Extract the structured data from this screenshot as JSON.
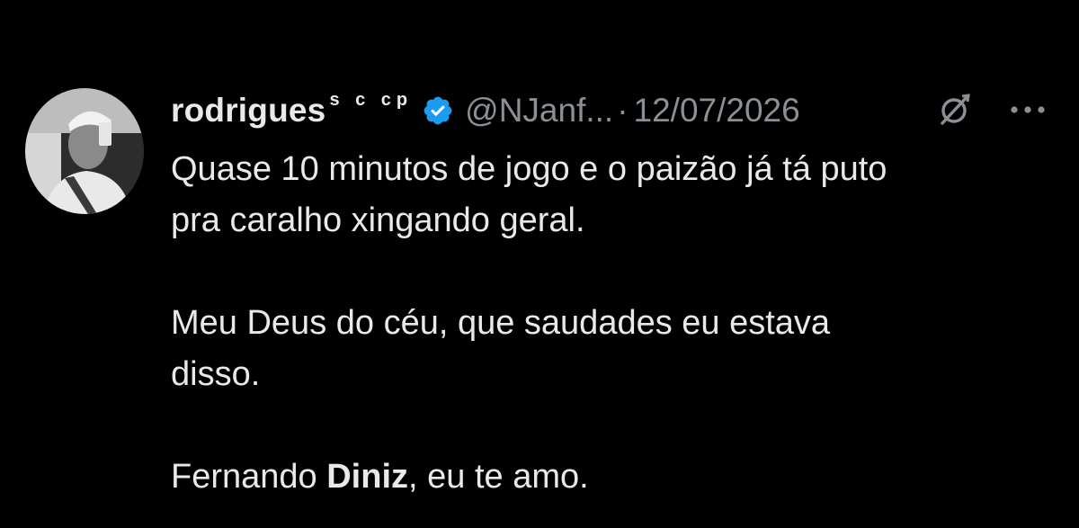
{
  "tweet": {
    "author": {
      "display_name": "rodrigues",
      "name_suffix": "s c cp",
      "handle": "@NJanf...",
      "verified": true
    },
    "separator": "·",
    "date": "12/07/2026",
    "icons": {
      "avatar": "avatar",
      "verified": "verified-badge-icon",
      "grok": "grok-icon",
      "more": "more-icon"
    },
    "colors": {
      "background": "#000000",
      "text": "#e7e9ea",
      "secondary_text": "#8b9096",
      "verified_blue": "#1d9bf0"
    },
    "text": {
      "line1": "Quase 10 minutos de jogo e o paizão já tá puto",
      "line2": "pra caralho xingando geral.",
      "line3": "Meu Deus do céu, que saudades eu estava",
      "line4": "disso.",
      "line5_prefix": "Fernando ",
      "line5_bold": "Diniz",
      "line5_suffix": ", eu te amo."
    }
  }
}
